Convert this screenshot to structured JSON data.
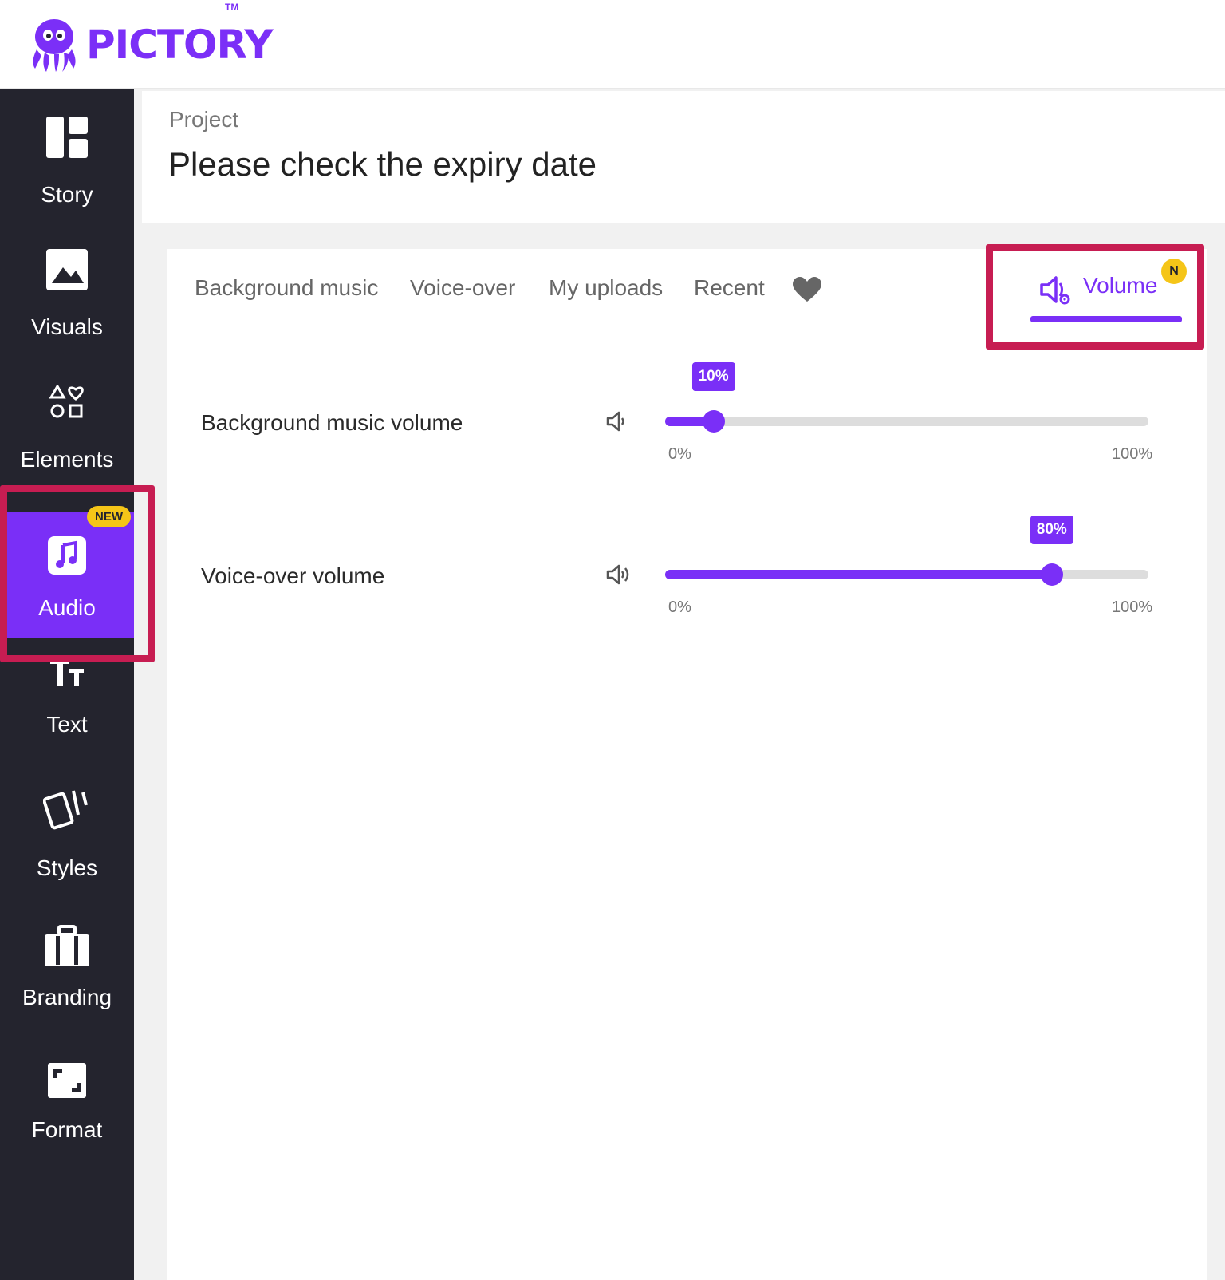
{
  "header": {
    "brand": "PICTORY",
    "trademark": "TM"
  },
  "sidebar": {
    "items": [
      {
        "label": "Story",
        "icon": "story-layout-icon"
      },
      {
        "label": "Visuals",
        "icon": "image-icon"
      },
      {
        "label": "Elements",
        "icon": "shapes-icon"
      },
      {
        "label": "Audio",
        "icon": "music-note-icon",
        "badge": "NEW",
        "active": true
      },
      {
        "label": "Text",
        "icon": "text-size-icon"
      },
      {
        "label": "Styles",
        "icon": "cards-icon"
      },
      {
        "label": "Branding",
        "icon": "briefcase-icon"
      },
      {
        "label": "Format",
        "icon": "aspect-ratio-icon"
      }
    ],
    "active_color": "#7a2ff7",
    "background": "#24242e"
  },
  "project": {
    "label": "Project",
    "title": "Please check the expiry date"
  },
  "audio_panel": {
    "tabs": [
      {
        "label": "Background music"
      },
      {
        "label": "Voice-over"
      },
      {
        "label": "My uploads"
      },
      {
        "label": "Recent"
      }
    ],
    "favorites_icon": "heart-icon",
    "volume_tab": {
      "label": "Volume",
      "badge": "N",
      "active": true
    },
    "sliders": [
      {
        "label": "Background music volume",
        "value": 10,
        "value_label": "10%",
        "min_label": "0%",
        "max_label": "100%"
      },
      {
        "label": "Voice-over volume",
        "value": 80,
        "value_label": "80%",
        "min_label": "0%",
        "max_label": "100%"
      }
    ]
  },
  "colors": {
    "accent": "#7a2ff7",
    "highlight_box": "#c71d52",
    "badge": "#f5c518"
  }
}
